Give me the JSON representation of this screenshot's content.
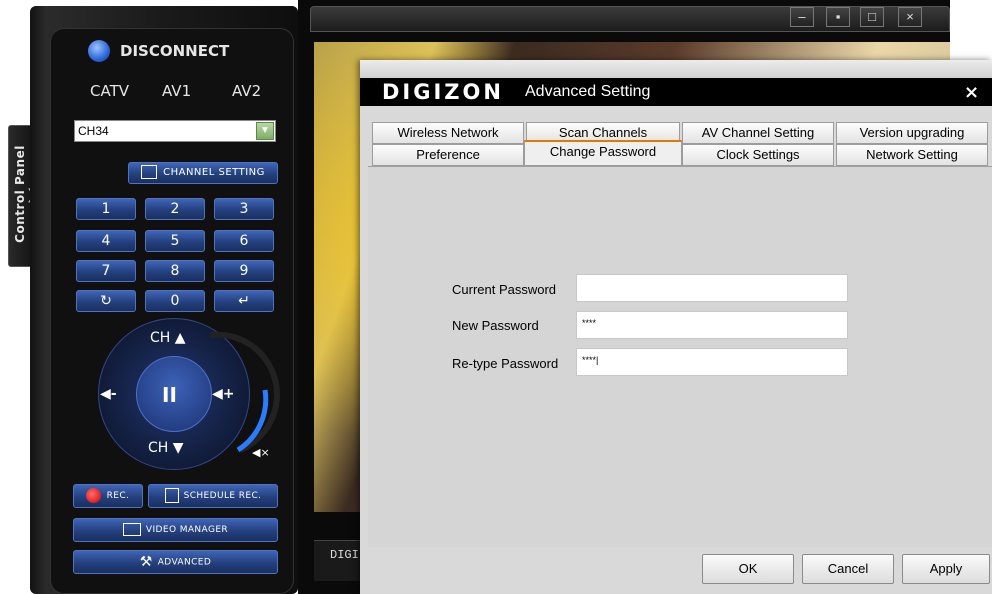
{
  "control_panel_tab": {
    "label": "Control Panel"
  },
  "remote": {
    "disconnect_label": "DISCONNECT",
    "sources": [
      "CATV",
      "AV1",
      "AV2"
    ],
    "channel_select": {
      "value": "CH34"
    },
    "channel_setting_label": "CHANNEL SETTING",
    "keypad": [
      "1",
      "2",
      "3",
      "4",
      "5",
      "6",
      "7",
      "8",
      "9",
      "↻",
      "0",
      "↵"
    ],
    "ch_up_label": "CH ▲",
    "ch_down_label": "CH ▼",
    "vol_down_label": "◀-",
    "vol_up_label": "◀+",
    "pause_label": "II",
    "mute_label": "◀×",
    "rec_label": "REC.",
    "schedule_rec_label": "SCHEDULE REC.",
    "video_manager_label": "VIDEO MANAGER",
    "advanced_label": "ADVANCED"
  },
  "video_window": {
    "controls": [
      "–",
      "▪",
      "□",
      "×"
    ],
    "bottom_text": "DIGI"
  },
  "dialog": {
    "logo": "DIGIZON",
    "title": "Advanced Setting",
    "close": "×",
    "tabs_row1": [
      "Wireless Network",
      "Scan Channels",
      "AV Channel Setting",
      "Version upgrading"
    ],
    "tabs_row2": [
      "Preference",
      "Change Password",
      "Clock Settings",
      "Network Setting"
    ],
    "active_tab": "Change Password",
    "fields": [
      {
        "label": "Current Password",
        "value": ""
      },
      {
        "label": "New Password",
        "value": "****"
      },
      {
        "label": "Re-type Password",
        "value": "****|"
      }
    ],
    "buttons": {
      "ok": "OK",
      "cancel": "Cancel",
      "apply": "Apply"
    }
  }
}
